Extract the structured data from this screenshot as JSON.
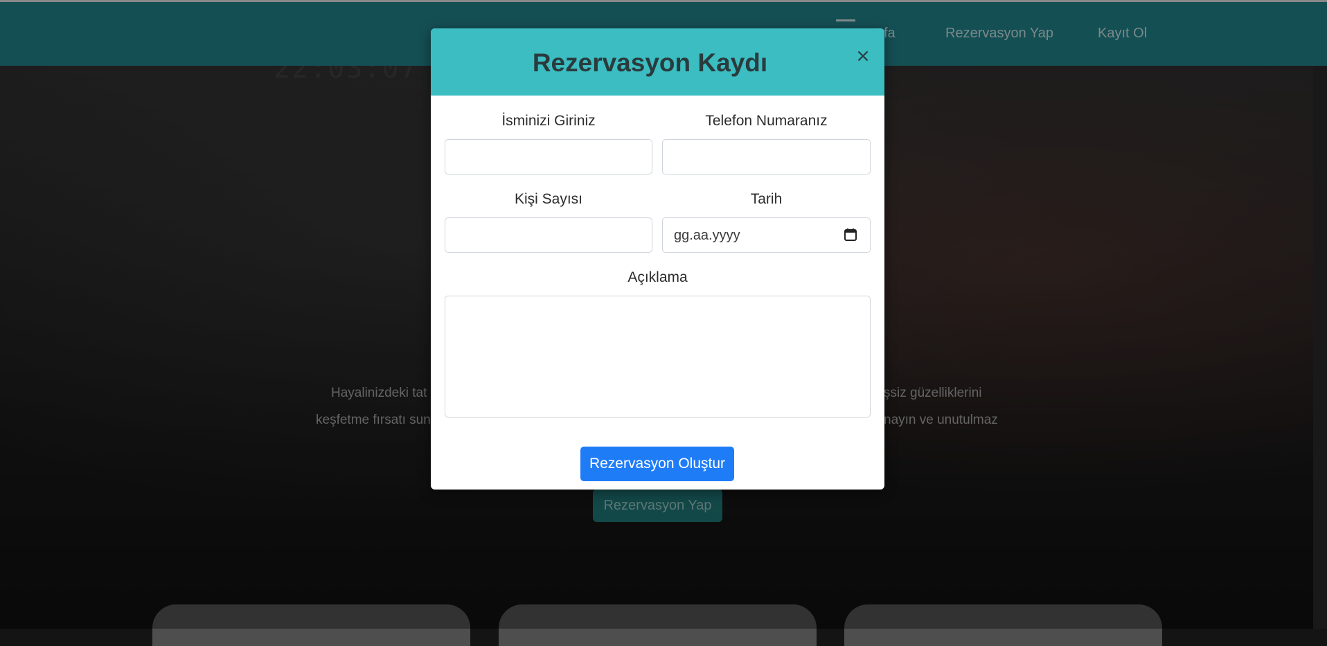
{
  "navbar": {
    "links": [
      "fa",
      "Rezervasyon Yap",
      "Kayıt Ol"
    ]
  },
  "hero": {
    "clock": "22:03:07",
    "text_left": [
      "Hayalinizdeki tat",
      "keşfetme fırsatı sun"
    ],
    "text_right": [
      "şsiz güzelliklerini",
      "nayın ve unutulmaz"
    ],
    "button": "Rezervasyon Yap"
  },
  "modal": {
    "title": "Rezervasyon Kaydı",
    "close": "×",
    "name_label": "İsminizi Giriniz",
    "phone_label": "Telefon Numaranız",
    "people_label": "Kişi Sayısı",
    "date_label": "Tarih",
    "date_placeholder": "gg.aa.yyyy",
    "description_label": "Açıklama",
    "submit": "Rezervasyon Oluştur"
  },
  "colors": {
    "navbar": "#1f7a82",
    "modal_header": "#3bbdc2",
    "primary_button": "#1f7cf7"
  },
  "icons": [
    "close-icon",
    "calendar-icon"
  ]
}
